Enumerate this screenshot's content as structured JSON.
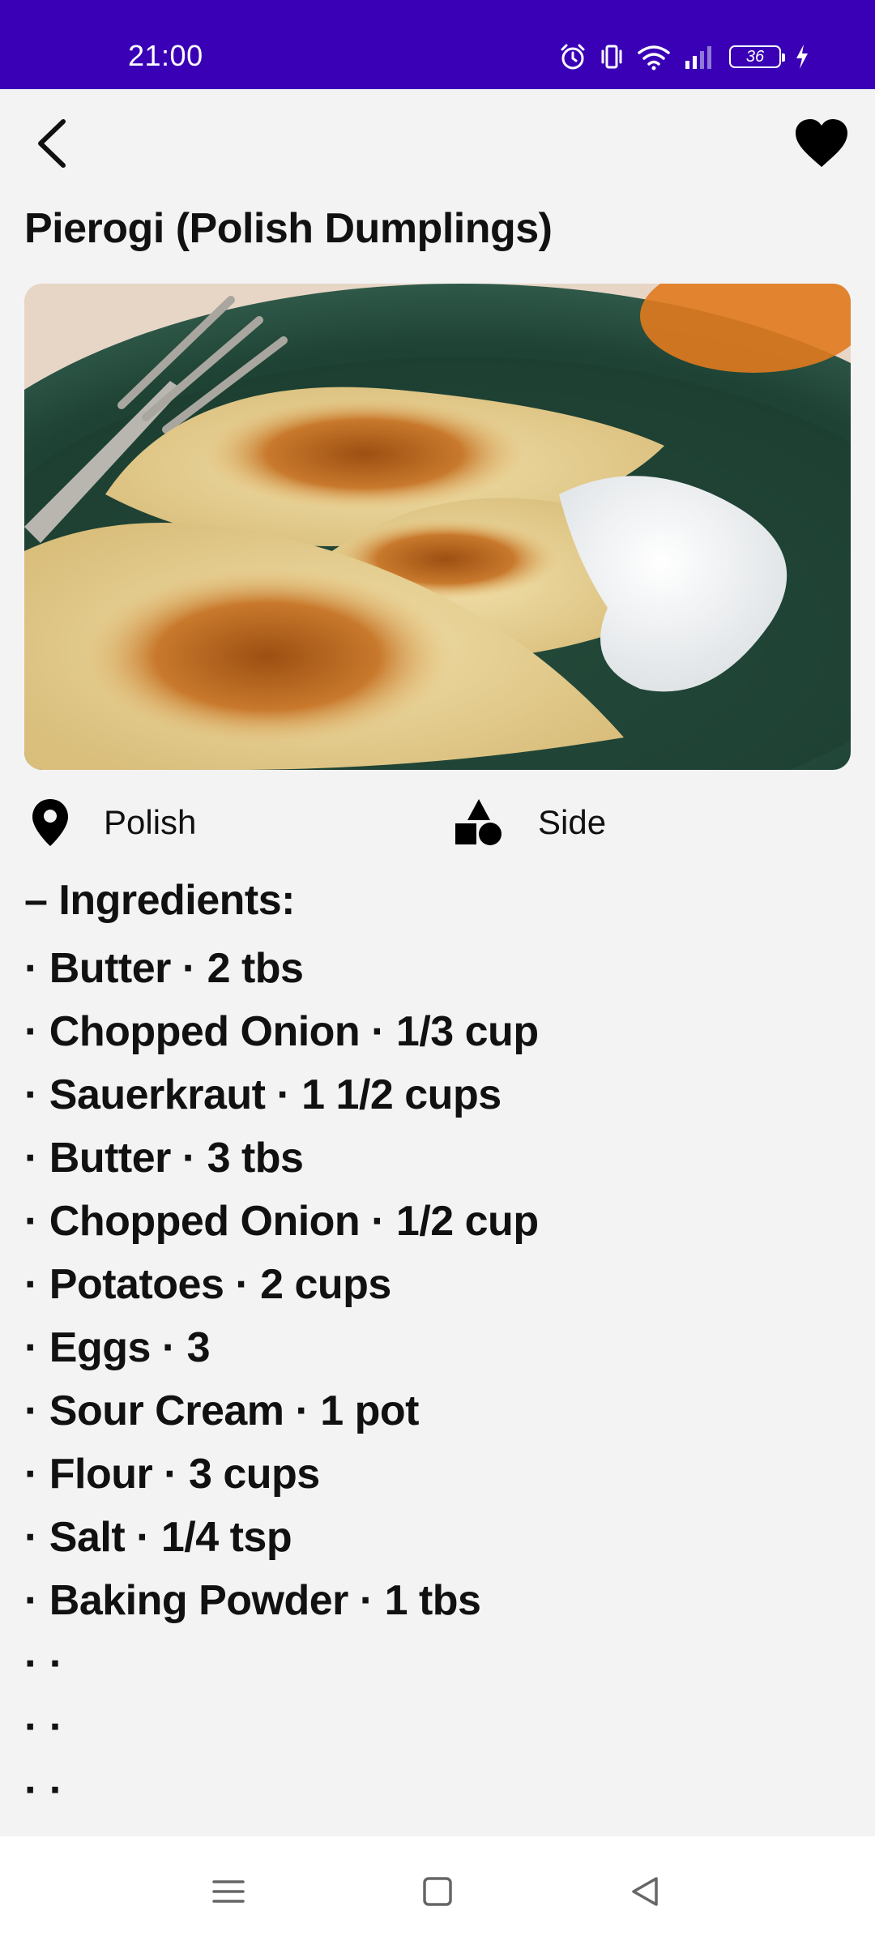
{
  "status_bar": {
    "time": "21:00",
    "battery_level": "36",
    "icons": [
      "alarm-icon",
      "vibrate-icon",
      "wifi-icon",
      "signal-icon",
      "battery-icon",
      "charging-icon"
    ]
  },
  "app_bar": {
    "back_icon": "back-arrow-icon",
    "favorite_icon": "heart-icon",
    "favorite_active": true
  },
  "recipe": {
    "title": "Pierogi (Polish Dumplings)",
    "area": "Polish",
    "category": "Side",
    "ingredients_heading": "– Ingredients:",
    "ingredients": [
      "· Butter · 2 tbs",
      "· Chopped Onion · 1/3 cup",
      "· Sauerkraut · 1 1/2 cups",
      "· Butter · 3 tbs",
      "· Chopped Onion · 1/2 cup",
      "· Potatoes · 2 cups",
      "· Eggs · 3",
      "· Sour Cream · 1 pot",
      "· Flour · 3 cups",
      "· Salt · 1/4 tsp",
      "· Baking Powder · 1 tbs",
      "·  ·",
      "·  ·",
      "·  ·"
    ]
  },
  "nav_bar": {
    "buttons": [
      "menu-icon",
      "home-icon",
      "back-icon"
    ]
  },
  "colors": {
    "status_bar": "#3a00b6",
    "background": "#f3f3f3",
    "text": "#111111"
  }
}
